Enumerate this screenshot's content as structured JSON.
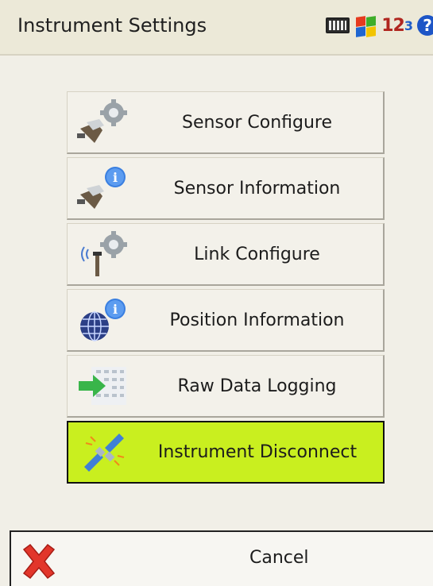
{
  "window": {
    "title": "Instrument Settings"
  },
  "tray": {
    "icons": [
      "keyboard-icon",
      "windows-flag-icon",
      "input-mode-icon",
      "help-icon"
    ],
    "input_mode_main": "12",
    "input_mode_sub": "3",
    "help_glyph": "?"
  },
  "menu": {
    "items": [
      {
        "label": "Sensor Configure",
        "icon": "sensor-gear-icon"
      },
      {
        "label": "Sensor Information",
        "icon": "sensor-info-icon"
      },
      {
        "label": "Link Configure",
        "icon": "antenna-gear-icon"
      },
      {
        "label": "Position Information",
        "icon": "globe-info-icon"
      },
      {
        "label": "Raw Data Logging",
        "icon": "data-log-arrow-icon"
      },
      {
        "label": "Instrument Disconnect",
        "icon": "plug-disconnect-icon",
        "highlighted": true
      }
    ]
  },
  "cancel": {
    "label": "Cancel",
    "icon": "red-x-icon"
  },
  "colors": {
    "highlight": "#c9ef1f",
    "background": "#f1efe7",
    "titlebar": "#ece9d8"
  }
}
